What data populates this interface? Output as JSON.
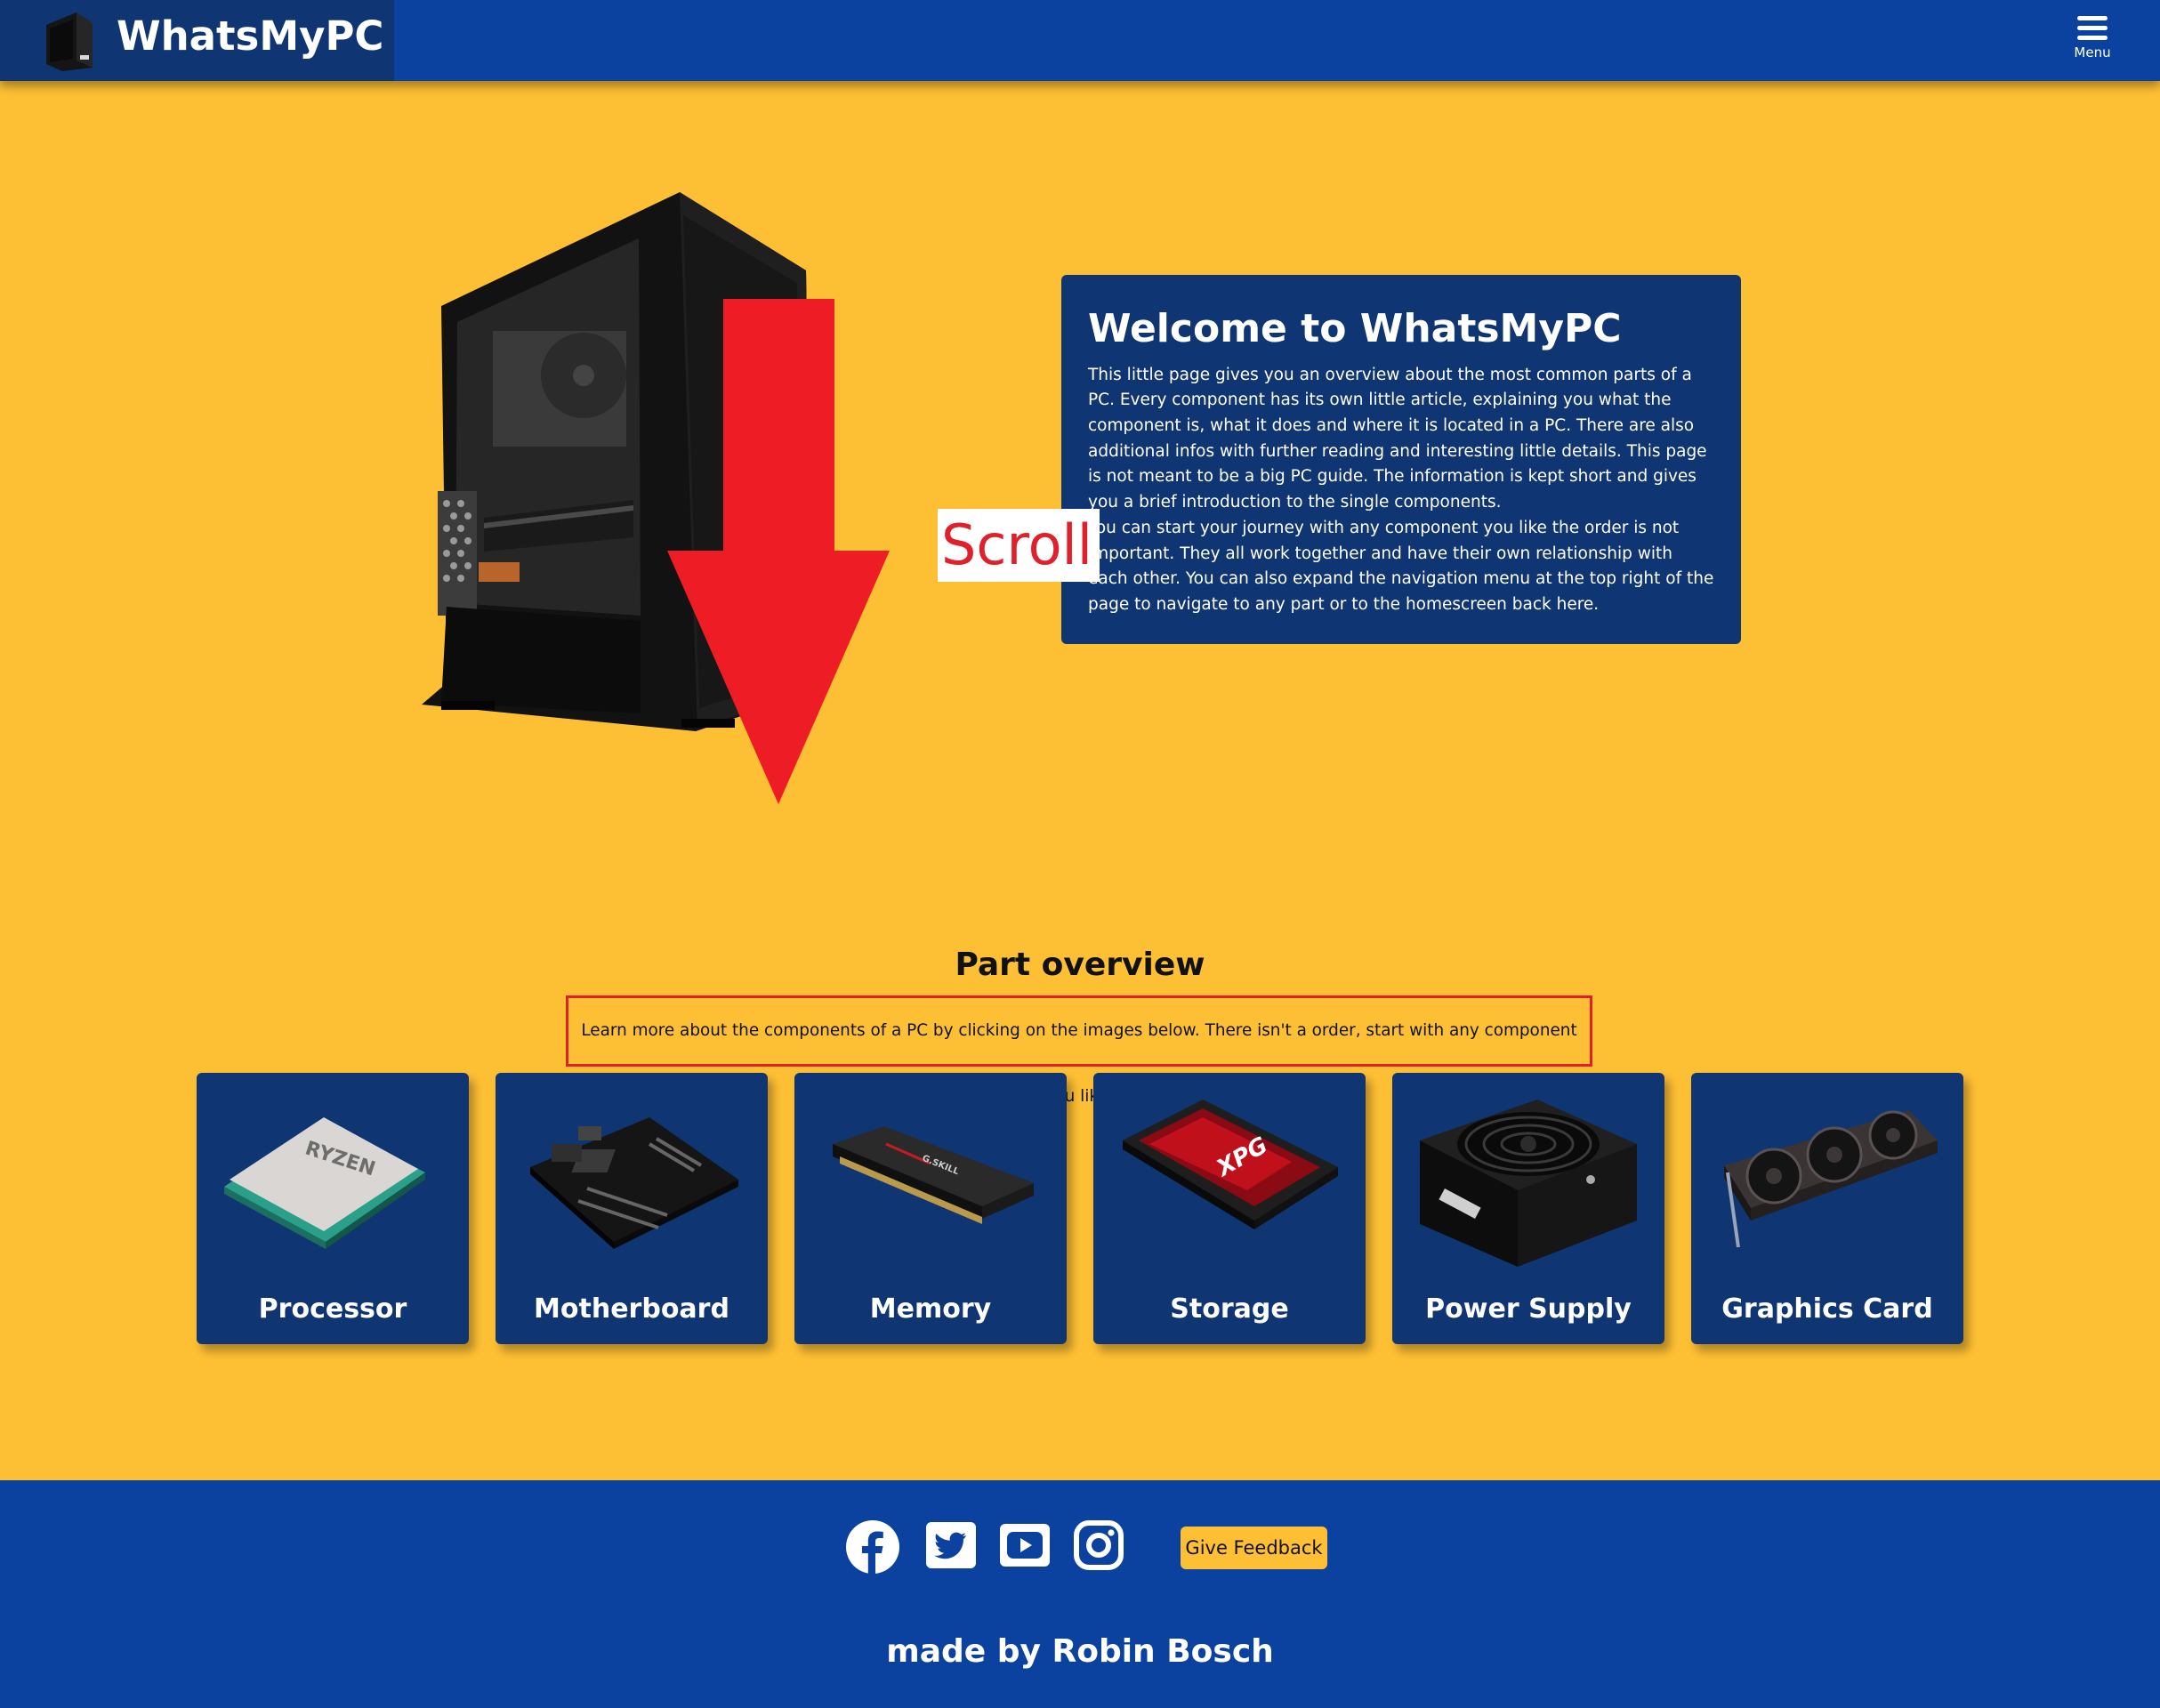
{
  "header": {
    "logo_icon": "pc-case-icon",
    "brand_name": "WhatsMyPC",
    "menu_icon": "hamburger-icon",
    "menu_label": "Menu"
  },
  "hero": {
    "scroll_label": "Scroll",
    "scroll_arrow_icon": "arrow-down-icon",
    "welcome_title": "Welcome to WhatsMyPC",
    "welcome_paragraph_1": "This little page gives you an overview about the most common parts of a PC. Every component has its own little article, explaining you what the component is, what it does and where it is located in a PC. There are also additional infos with further reading and interesting little details. This page is not meant to be a big PC guide. The information is kept short and gives you a brief introduction to the single components.",
    "welcome_paragraph_2": "You can start your journey with any component you like the order is not important. They all work together and have their own relationship with each other. You can also expand the navigation menu at the top right of the page to navigate to any part or to the homescreen back here."
  },
  "parts": {
    "title": "Part overview",
    "intro": "Learn more about the components of a PC by clicking on the images below. There isn't a order, start with any component you like.",
    "items": [
      {
        "label": "Processor",
        "icon": "cpu-icon"
      },
      {
        "label": "Motherboard",
        "icon": "motherboard-icon"
      },
      {
        "label": "Memory",
        "icon": "ram-icon"
      },
      {
        "label": "Storage",
        "icon": "ssd-icon"
      },
      {
        "label": "Power Supply",
        "icon": "psu-icon"
      },
      {
        "label": "Graphics Card",
        "icon": "gpu-icon"
      }
    ]
  },
  "footer": {
    "social_icons": [
      "facebook-icon",
      "twitter-icon",
      "youtube-icon",
      "instagram-icon"
    ],
    "feedback_label": "Give Feedback",
    "made_by": "made by Robin Bosch"
  },
  "colors": {
    "page_background": "#FDBF33",
    "header_background": "#0B42A0",
    "card_background": "#0F3572",
    "accent_red": "#E0202A"
  }
}
